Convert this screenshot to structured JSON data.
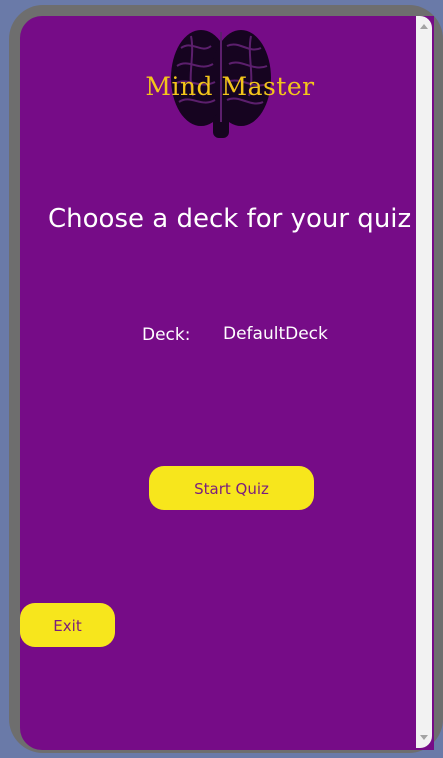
{
  "app": {
    "logo_text": "Mind Master",
    "logo_icon": "brain-icon"
  },
  "main": {
    "heading": "Choose a deck for your quiz",
    "deck_label": "Deck:",
    "deck_value": "DefaultDeck",
    "start_label": "Start Quiz",
    "exit_label": "Exit"
  },
  "colors": {
    "background": "#760c87",
    "button": "#f7e61c",
    "button_text": "#7a1e7e",
    "logo_text": "#f3c51b",
    "frame": "#6e6e6e"
  }
}
